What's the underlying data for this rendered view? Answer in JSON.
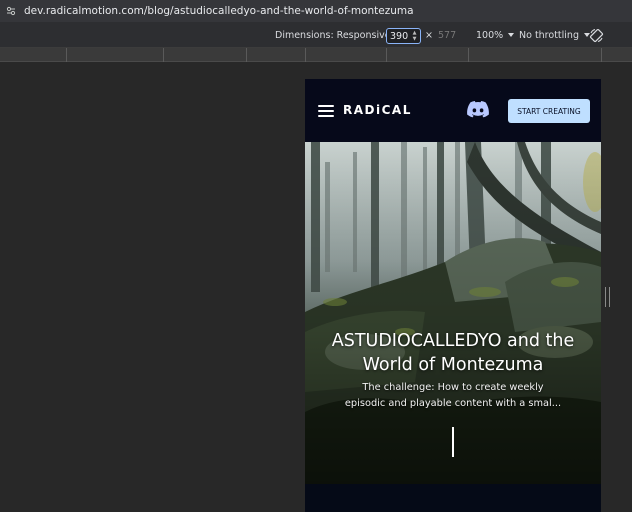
{
  "browser": {
    "url": "dev.radicalmotion.com/blog/astudiocalledyo-and-the-world-of-montezuma"
  },
  "devtools": {
    "dimensions_label": "Dimensions: Responsive",
    "width_value": "390",
    "times_symbol": "×",
    "height_value": "577",
    "zoom": "100%",
    "throttling": "No throttling",
    "rotate_icon": "rotate-icon"
  },
  "site": {
    "logo": "RADiCAL",
    "discord_icon": "discord-icon",
    "cta_label": "START CREATING",
    "cta_color": "#bfdfff",
    "header_bg": "#06091a"
  },
  "hero": {
    "title_line1": "ASTUDIOCALLEDYO and the",
    "title_line2": "World of Montezuma",
    "subtitle_line1": "The challenge: How to create weekly",
    "subtitle_line2": "episodic and playable content with a smal..."
  }
}
